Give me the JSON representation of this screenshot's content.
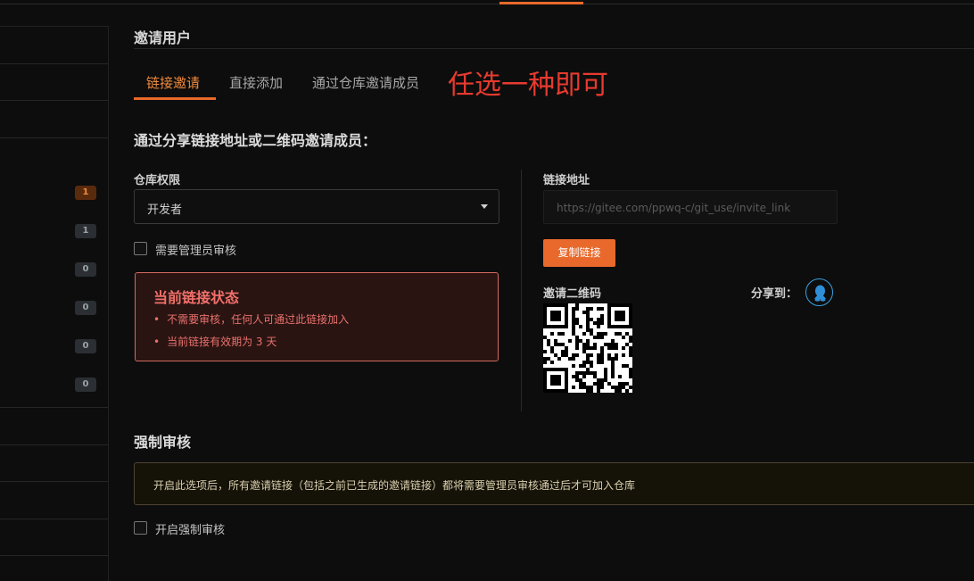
{
  "sidebar": {
    "badges": [
      "1",
      "1",
      "0",
      "0",
      "0",
      "0"
    ]
  },
  "page": {
    "title": "邀请用户"
  },
  "tabs": [
    {
      "label": "链接邀请"
    },
    {
      "label": "直接添加"
    },
    {
      "label": "通过仓库邀请成员"
    }
  ],
  "annotation": "任选一种即可",
  "share_section": {
    "heading": "通过分享链接地址或二维码邀请成员：",
    "permission_label": "仓库权限",
    "permission_value": "开发者",
    "require_admin_label": "需要管理员审核",
    "status": {
      "title": "当前链接状态",
      "items": [
        "不需要审核，任何人可通过此链接加入",
        "当前链接有效期为 3 天"
      ]
    },
    "link_label": "链接地址",
    "link_placeholder": "https://gitee.com/ppwq-c/git_use/invite_link",
    "copy_button": "复制链接",
    "qr_label": "邀请二维码",
    "share_to_label": "分享到："
  },
  "force_review": {
    "heading": "强制审核",
    "notice": "开启此选项后，所有邀请链接（包括之前已生成的邀请链接）都将需要管理员审核通过后才可加入仓库",
    "checkbox_label": "开启强制审核"
  },
  "colors": {
    "accent": "#e8692b",
    "danger": "#f0706a",
    "annotation": "#e83a2f"
  }
}
